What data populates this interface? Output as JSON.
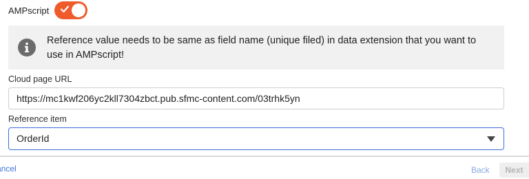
{
  "ampscript": {
    "label": "AMPscript",
    "enabled": true,
    "toggle_color": "#ef5b2a"
  },
  "banner": {
    "icon": "info-icon",
    "message": "Reference value needs to be same as field name (unique filed) in data extension that you want to use in AMPscript!"
  },
  "cloud_page_url": {
    "label": "Cloud page URL",
    "value": "https://mc1kwf206yc2kll7304zbct.pub.sfmc-content.com/03trhk5yn"
  },
  "reference_item": {
    "label": "Reference item",
    "selected": "OrderId"
  },
  "footer": {
    "cancel_label": "ancel",
    "back_label": "Back",
    "next_label": "Next"
  },
  "colors": {
    "accent": "#3b6fd9",
    "banner_bg": "#f1f1f1"
  }
}
